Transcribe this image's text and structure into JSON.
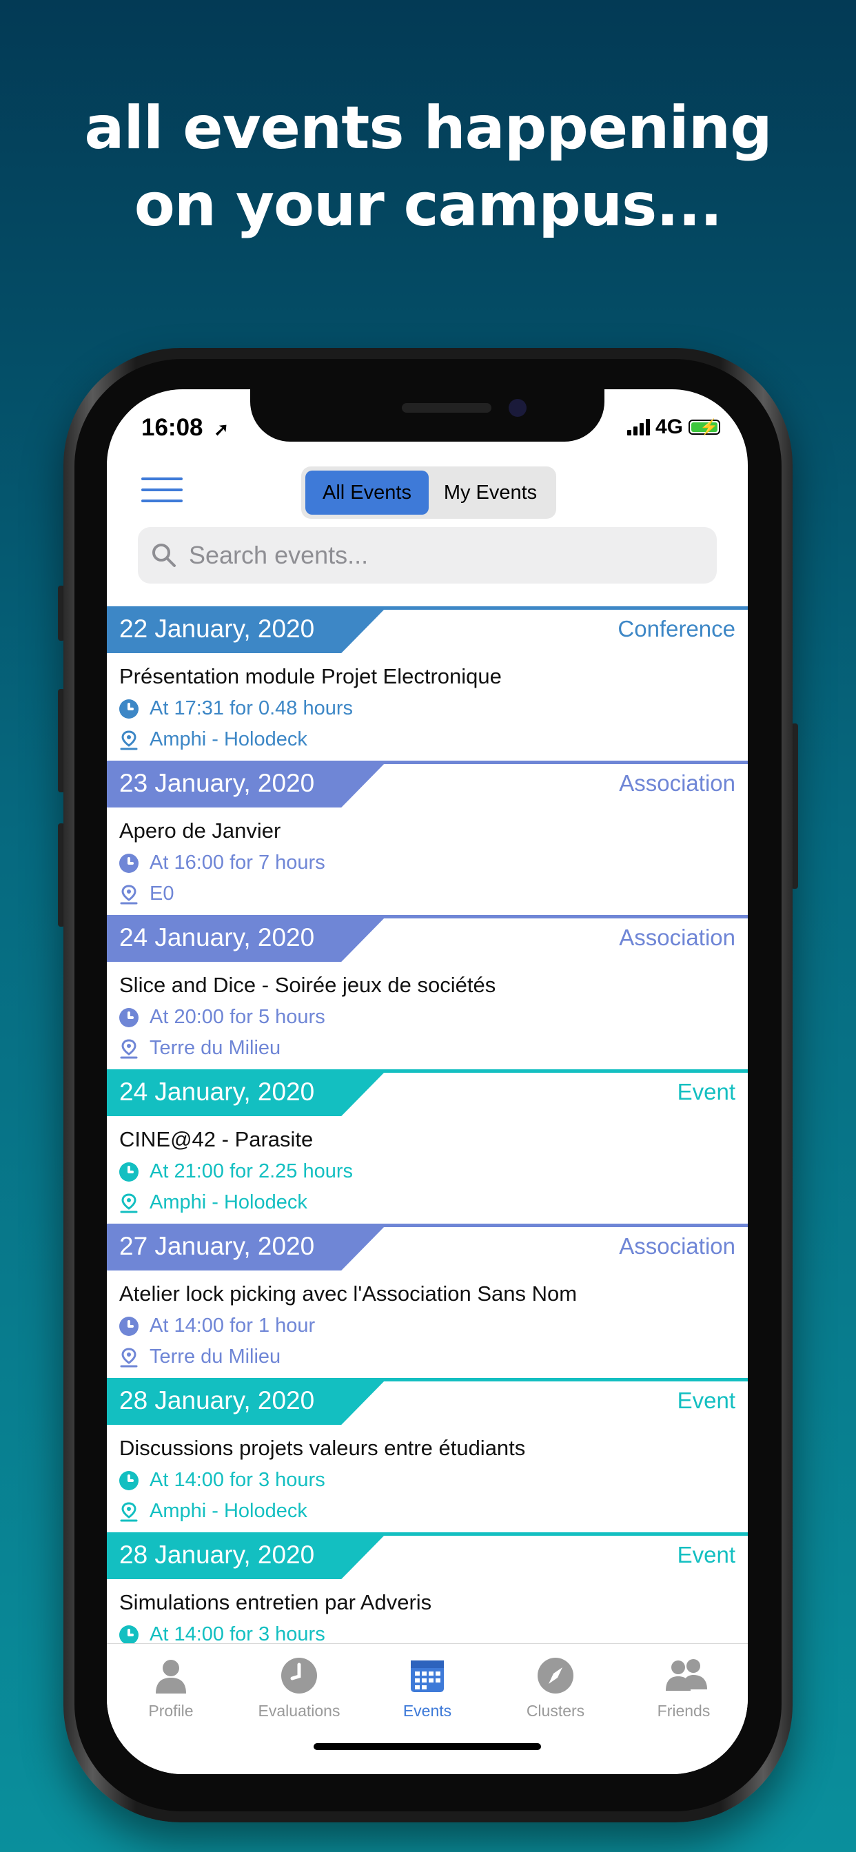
{
  "headline": {
    "line1": "all events happening",
    "line2": "on your campus..."
  },
  "status_bar": {
    "time": "16:08",
    "network": "4G"
  },
  "segmented": {
    "all_events": "All Events",
    "my_events": "My Events"
  },
  "search": {
    "placeholder": "Search events..."
  },
  "colors": {
    "conference": "#3d87c6",
    "association": "#6f86d6",
    "event": "#13bfc1",
    "accent": "#3e7ad8"
  },
  "events": [
    {
      "date": "22 January, 2020",
      "category": "Conference",
      "title": "Présentation module Projet Electronique",
      "time": "At 17:31 for 0.48 hours",
      "location": "Amphi - Holodeck"
    },
    {
      "date": "23 January, 2020",
      "category": "Association",
      "title": "Apero de Janvier",
      "time": "At 16:00 for 7 hours",
      "location": "E0"
    },
    {
      "date": "24 January, 2020",
      "category": "Association",
      "title": "Slice and Dice - Soirée jeux de sociétés",
      "time": "At 20:00 for 5 hours",
      "location": "Terre du Milieu"
    },
    {
      "date": "24 January, 2020",
      "category": "Event",
      "title": "CINE@42 - Parasite",
      "time": "At 21:00 for 2.25 hours",
      "location": "Amphi - Holodeck"
    },
    {
      "date": "27 January, 2020",
      "category": "Association",
      "title": "Atelier lock picking avec l'Association Sans Nom",
      "time": "At 14:00 for 1 hour",
      "location": "Terre du Milieu"
    },
    {
      "date": "28 January, 2020",
      "category": "Event",
      "title": "Discussions projets valeurs entre étudiants",
      "time": "At 14:00 for 3 hours",
      "location": "Amphi - Holodeck"
    },
    {
      "date": "28 January, 2020",
      "category": "Event",
      "title": "Simulations entretien par Adveris",
      "time": "At 14:00 for 3 hours",
      "location": ""
    }
  ],
  "tabs": [
    {
      "label": "Profile",
      "icon": "person-icon"
    },
    {
      "label": "Evaluations",
      "icon": "clock-icon"
    },
    {
      "label": "Events",
      "icon": "calendar-icon",
      "active": true
    },
    {
      "label": "Clusters",
      "icon": "compass-icon"
    },
    {
      "label": "Friends",
      "icon": "friends-icon"
    }
  ]
}
